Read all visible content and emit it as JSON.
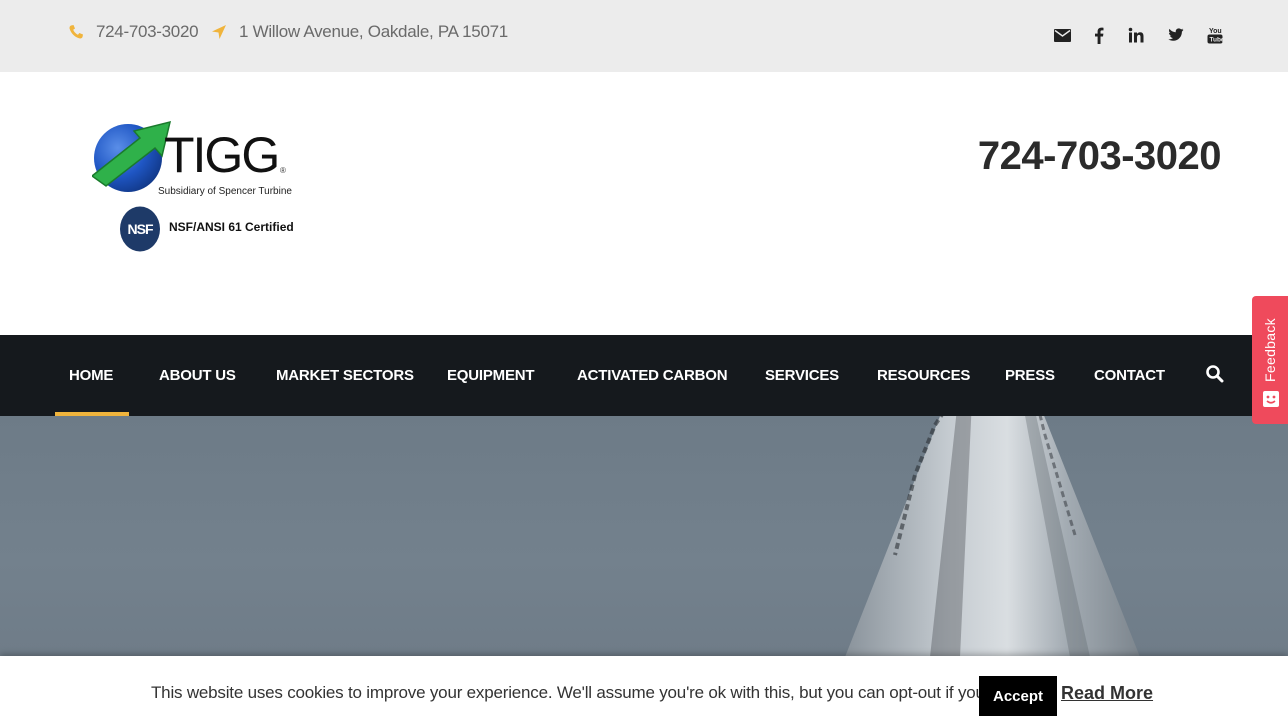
{
  "topbar": {
    "phone": "724-703-3020",
    "address": "1 Willow Avenue, Oakdale, PA 15071",
    "icon_color": "#f0b43c",
    "social": [
      {
        "name": "email-icon",
        "glyph": "✉"
      },
      {
        "name": "facebook-icon",
        "glyph": "f"
      },
      {
        "name": "linkedin-icon",
        "glyph": "in"
      },
      {
        "name": "twitter-icon",
        "glyph": "🐦"
      },
      {
        "name": "youtube-icon",
        "glyph": "You"
      }
    ]
  },
  "header": {
    "logo_text": "TIGG",
    "logo_registered": "®",
    "logo_subtitle": "Subsidiary of Spencer Turbine",
    "nsf_badge": "NSF",
    "nsf_text": "NSF/ANSI 61 Certified",
    "phone": "724-703-3020"
  },
  "nav": {
    "items": [
      {
        "label": "HOME",
        "active": true
      },
      {
        "label": "ABOUT US"
      },
      {
        "label": "MARKET SECTORS"
      },
      {
        "label": "EQUIPMENT"
      },
      {
        "label": "ACTIVATED CARBON"
      },
      {
        "label": "SERVICES"
      },
      {
        "label": "RESOURCES"
      },
      {
        "label": "PRESS"
      },
      {
        "label": "CONTACT"
      }
    ],
    "accent": "#f0b43c",
    "background": "#15191d"
  },
  "feedback": {
    "label": "Feedback",
    "color": "#ef4a5c"
  },
  "cookie": {
    "message": "This website uses cookies to improve your experience. We'll assume you're ok with this, but you can opt-out if you wish.",
    "accept_label": "Accept",
    "read_more_label": "Read More"
  }
}
